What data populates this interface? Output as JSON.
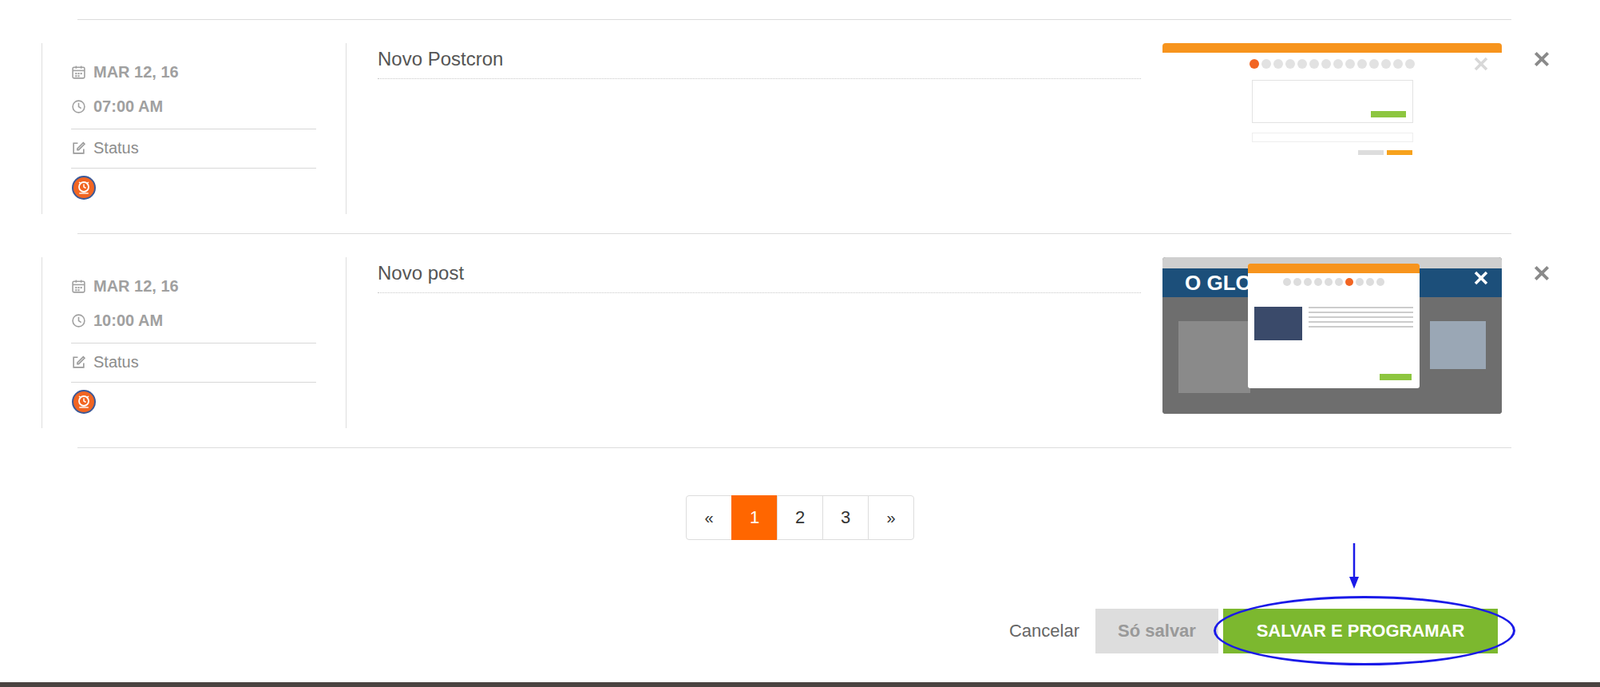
{
  "posts": [
    {
      "date": "MAR 12, 16",
      "time": "07:00 AM",
      "type": "Status",
      "title": "Novo Postcron",
      "preview": {
        "kind": "editor"
      }
    },
    {
      "date": "MAR 12, 16",
      "time": "10:00 AM",
      "type": "Status",
      "title": "Novo post",
      "preview": {
        "kind": "site",
        "label": "O GLOB"
      }
    }
  ],
  "pagination": {
    "prev": "«",
    "next": "»",
    "pages": [
      {
        "label": "1",
        "selected": true
      },
      {
        "label": "2",
        "selected": false
      },
      {
        "label": "3",
        "selected": false
      }
    ]
  },
  "buttons": [
    {
      "label": "Cancelar",
      "kind": "link",
      "highlighted": false
    },
    {
      "label": "Só salvar",
      "kind": "secondary",
      "highlighted": false
    },
    {
      "label": "SALVAR E PROGRAMAR",
      "kind": "primary",
      "highlighted": true
    }
  ]
}
